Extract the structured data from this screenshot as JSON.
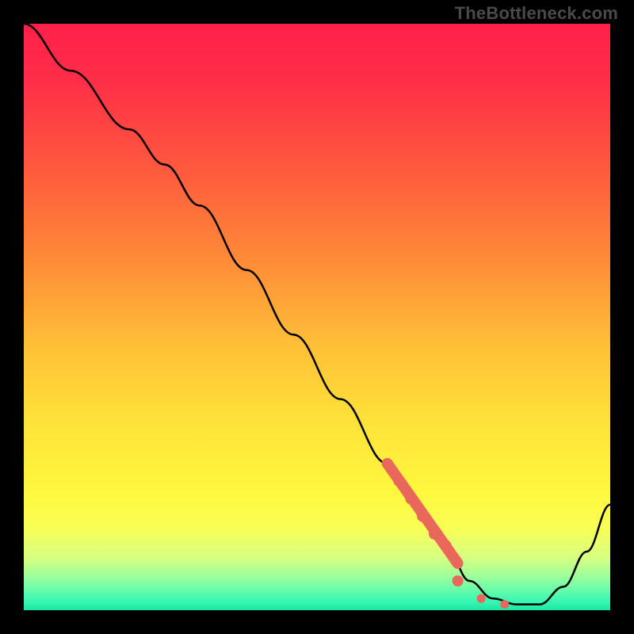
{
  "watermark": "TheBottleneck.com",
  "colors": {
    "frame": "#000000",
    "curve": "#000000",
    "marker": "#e9675b",
    "gradient_stops": [
      {
        "offset": 0.0,
        "color": "#ff1f4b"
      },
      {
        "offset": 0.1,
        "color": "#ff2f47"
      },
      {
        "offset": 0.25,
        "color": "#ff5a3e"
      },
      {
        "offset": 0.4,
        "color": "#ff8a38"
      },
      {
        "offset": 0.55,
        "color": "#ffc038"
      },
      {
        "offset": 0.68,
        "color": "#ffe239"
      },
      {
        "offset": 0.8,
        "color": "#fff83e"
      },
      {
        "offset": 0.86,
        "color": "#f8ff55"
      },
      {
        "offset": 0.91,
        "color": "#d8ff82"
      },
      {
        "offset": 0.95,
        "color": "#8dffa1"
      },
      {
        "offset": 0.985,
        "color": "#38f7b3"
      },
      {
        "offset": 1.0,
        "color": "#19e7a2"
      }
    ]
  },
  "chart_data": {
    "type": "line",
    "title": "",
    "xlabel": "",
    "ylabel": "",
    "xlim": [
      0,
      100
    ],
    "ylim": [
      0,
      100
    ],
    "grid": false,
    "legend": false,
    "series": [
      {
        "name": "bottleneck-curve",
        "x": [
          0,
          8,
          18,
          24,
          30,
          38,
          46,
          54,
          62,
          67,
          72,
          76,
          80,
          84,
          88,
          92,
          96,
          100
        ],
        "y": [
          100,
          92,
          82,
          76,
          69,
          58,
          47,
          36,
          25,
          18,
          11,
          5,
          2,
          1,
          1,
          4,
          10,
          18
        ]
      }
    ],
    "markers": {
      "name": "highlight-segment",
      "x": [
        62,
        64,
        66,
        68,
        70,
        72,
        74,
        78,
        82
      ],
      "y": [
        25,
        22,
        19,
        16,
        13,
        11,
        5,
        2,
        1
      ],
      "style": "filled-circle",
      "thick_range_x": [
        62,
        74
      ]
    }
  }
}
